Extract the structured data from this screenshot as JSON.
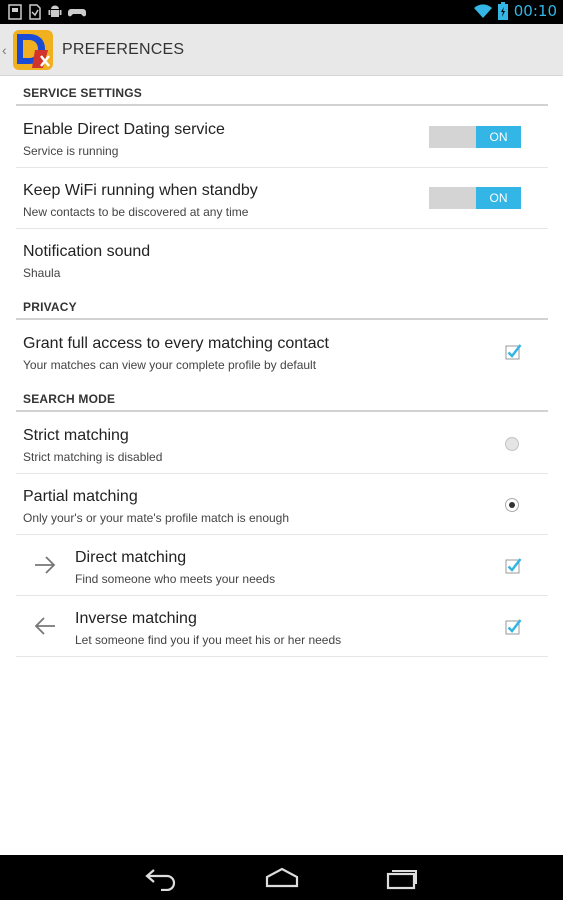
{
  "status_bar": {
    "time": "00:10",
    "left_icons": [
      "notification-icon",
      "document-icon",
      "android-icon",
      "gamepad-icon"
    ],
    "right_icons": [
      "wifi-icon",
      "battery-icon"
    ]
  },
  "action_bar": {
    "title": "PREFERENCES",
    "logo_icon": "direct-dating-logo",
    "up_glyph": "‹"
  },
  "sections": {
    "service": {
      "header": "SERVICE SETTINGS",
      "enable_service": {
        "title": "Enable Direct Dating service",
        "summary": "Service is running",
        "switch_label": "ON",
        "on": true
      },
      "keep_wifi": {
        "title": "Keep WiFi running when standby",
        "summary": "New contacts to be discovered at any time",
        "switch_label": "ON",
        "on": true
      },
      "notification_sound": {
        "title": "Notification sound",
        "summary": "Shaula"
      }
    },
    "privacy": {
      "header": "PRIVACY",
      "grant_access": {
        "title": "Grant full access to every matching contact",
        "summary": "Your matches can view your complete profile by default",
        "checked": true
      }
    },
    "search_mode": {
      "header": "SEARCH MODE",
      "strict": {
        "title": "Strict matching",
        "summary": "Strict matching is disabled",
        "selected": false
      },
      "partial": {
        "title": "Partial matching",
        "summary": "Only your's or your mate's profile match is enough",
        "selected": true
      },
      "direct": {
        "title": "Direct matching",
        "summary": "Find someone who meets your needs",
        "checked": true,
        "icon": "arrow-right-icon"
      },
      "inverse": {
        "title": "Inverse matching",
        "summary": "Let someone find you if you meet his or her needs",
        "checked": true,
        "icon": "arrow-left-icon"
      }
    }
  },
  "nav_bar": {
    "buttons": [
      "back-icon",
      "home-icon",
      "recent-apps-icon"
    ]
  },
  "colors": {
    "accent": "#33b5e5",
    "status_bar": "#000000",
    "action_bar": "#e8e8e8",
    "switch_track": "#d4d4d4"
  }
}
